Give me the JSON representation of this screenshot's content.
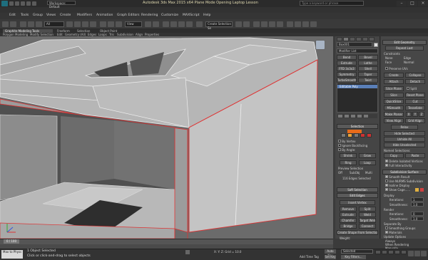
{
  "title_bar": {
    "title": "Autodesk 3ds Max 2015 x64   Plane Mode Opening Laptop Lesson",
    "search_placeholder": "Type a keyword or phrase"
  },
  "quick_access": {
    "workspace": "Workspace: Default"
  },
  "menu": {
    "items": [
      "Edit",
      "Tools",
      "Group",
      "Views",
      "Create",
      "Modifiers",
      "Animation",
      "Graph Editors",
      "Rendering",
      "Customize",
      "MAXScript",
      "Help"
    ]
  },
  "main_toolbar": {
    "selection_filter": "All",
    "view_dropdown": "View",
    "create_selection_set": "Create Selection Se"
  },
  "ribbon": {
    "active": "Graphite Modeling Tools",
    "top_tabs": [
      "Freeform",
      "Selection",
      "Object Paint"
    ],
    "tabs": [
      "Polygon Modeling",
      "Modify Selection",
      "Edit",
      "Geometry (All)",
      "Edges",
      "Loops",
      "Tris",
      "Subdivision",
      "Align",
      "Properties"
    ]
  },
  "command_panel": {
    "object_name": "Box001",
    "modifier_list": "Modifier List",
    "left_buttons": [
      [
        "Bend",
        "Bevel"
      ],
      [
        "Extrude",
        "Lathe"
      ],
      [
        "FFD 3x3x3",
        "Shell"
      ],
      [
        "Symmetry",
        "Taper"
      ],
      [
        "TurboSmooth",
        "Twist"
      ]
    ],
    "stack_item": "Editable Poly",
    "selection_title": "Selection",
    "options": {
      "by_vertex": "By Vertex",
      "ignore_backfacing": "Ignore Backfacing",
      "by_angle": "By Angle:",
      "shrink": "Shrink",
      "grow": "Grow",
      "ring": "Ring",
      "loop": "Loop",
      "preview_selection": "Preview Selection",
      "off": "Off",
      "subobj": "SubObj",
      "multi": "Multi",
      "edges_selected": "116 Edges Selected"
    },
    "soft_selection": "Soft Selection",
    "edit_edges": "Edit Edges",
    "insert_vertex": "Insert Vertex",
    "edge_buttons": [
      [
        "Remove",
        "Split"
      ],
      [
        "Extrude",
        "Weld"
      ],
      [
        "Chamfer",
        "Target Weld"
      ],
      [
        "Bridge",
        "Connect"
      ]
    ],
    "create_shape": "Create Shape From Selection",
    "weight_label": "Weight:",
    "right": {
      "edit_geometry": "Edit Geometry",
      "repeat_last": "Repeat Last",
      "constraints": "Constraints",
      "none": "None",
      "edge": "Edge",
      "face": "Face",
      "normal": "Normal",
      "preserve_uvs": "Preserve UVs",
      "create": "Create",
      "collapse": "Collapse",
      "attach": "Attach",
      "detach": "Detach",
      "slice_plane": "Slice Plane",
      "split": "Split",
      "slice": "Slice",
      "reset_plane": "Reset Plane",
      "quickslice": "QuickSlice",
      "cut": "Cut",
      "msmooth": "MSmooth",
      "tessellate": "Tessellate",
      "make_planar": "Make Planar",
      "x": "X",
      "y": "Y",
      "z": "Z",
      "view_align": "View Align",
      "grid_align": "Grid Align",
      "relax": "Relax",
      "hide_selected": "Hide Selected",
      "unhide_all": "Unhide All",
      "hide_unselected": "Hide Unselected",
      "named_selections": "Named Selections:",
      "copy": "Copy",
      "paste": "Paste",
      "delete_isolated": "Delete Isolated Vertices",
      "full_interactivity": "Full Interactivity",
      "subdivision_surface": "Subdivision Surface",
      "smooth_result": "Smooth Result",
      "use_nurms": "Use NURMS Subdivision",
      "isoline_display": "Isoline Display",
      "show_cage": "Show Cage......",
      "display": "Display",
      "iterations": "Iterations:",
      "iterations_val": "1",
      "smoothness": "Smoothness:",
      "smoothness_val": "1.0",
      "render": "Render",
      "r_iterations_val": "0",
      "r_smoothness_val": "1.0",
      "separate_by": "Separate By",
      "smoothing_groups": "Smoothing Groups",
      "materials": "Materials",
      "update_options": "Update Options",
      "always": "Always",
      "when_rendering": "When Rendering",
      "manually": "Manually"
    }
  },
  "timeline": {
    "slider": "0 / 100"
  },
  "status": {
    "maxscript": "Max to Physc",
    "line1": "1 Object Selected",
    "line2": "Click or click-and-drag to select objects",
    "coords": "X:       Y:       Z:       Grid = 10.0",
    "add_time_tag": "Add Time Tag",
    "auto_key": "Auto Key",
    "set_key": "Set Key",
    "selected": "Selected",
    "key_filters": "Key Filters..."
  }
}
